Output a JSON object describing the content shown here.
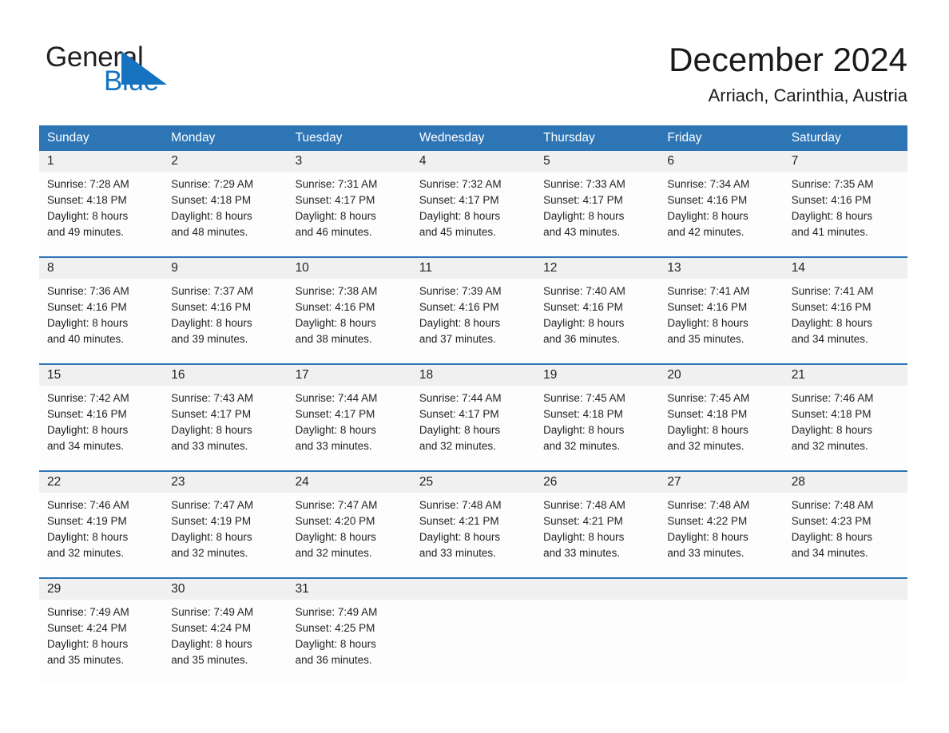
{
  "brand": {
    "name_part1": "General",
    "name_part2": "Blue",
    "triangle_icon": "blue-triangle-icon",
    "accent_color": "#1673c0"
  },
  "header": {
    "title": "December 2024",
    "subtitle": "Arriach, Carinthia, Austria"
  },
  "theme": {
    "header_blue": "#2e75b6",
    "date_band_gray": "#f0f0f0",
    "text_dark": "#231f20"
  },
  "calendar": {
    "day_headers": [
      "Sunday",
      "Monday",
      "Tuesday",
      "Wednesday",
      "Thursday",
      "Friday",
      "Saturday"
    ],
    "weeks": [
      [
        {
          "day": "1",
          "sunrise": "Sunrise: 7:28 AM",
          "sunset": "Sunset: 4:18 PM",
          "daylight_line1": "Daylight: 8 hours",
          "daylight_line2": "and 49 minutes."
        },
        {
          "day": "2",
          "sunrise": "Sunrise: 7:29 AM",
          "sunset": "Sunset: 4:18 PM",
          "daylight_line1": "Daylight: 8 hours",
          "daylight_line2": "and 48 minutes."
        },
        {
          "day": "3",
          "sunrise": "Sunrise: 7:31 AM",
          "sunset": "Sunset: 4:17 PM",
          "daylight_line1": "Daylight: 8 hours",
          "daylight_line2": "and 46 minutes."
        },
        {
          "day": "4",
          "sunrise": "Sunrise: 7:32 AM",
          "sunset": "Sunset: 4:17 PM",
          "daylight_line1": "Daylight: 8 hours",
          "daylight_line2": "and 45 minutes."
        },
        {
          "day": "5",
          "sunrise": "Sunrise: 7:33 AM",
          "sunset": "Sunset: 4:17 PM",
          "daylight_line1": "Daylight: 8 hours",
          "daylight_line2": "and 43 minutes."
        },
        {
          "day": "6",
          "sunrise": "Sunrise: 7:34 AM",
          "sunset": "Sunset: 4:16 PM",
          "daylight_line1": "Daylight: 8 hours",
          "daylight_line2": "and 42 minutes."
        },
        {
          "day": "7",
          "sunrise": "Sunrise: 7:35 AM",
          "sunset": "Sunset: 4:16 PM",
          "daylight_line1": "Daylight: 8 hours",
          "daylight_line2": "and 41 minutes."
        }
      ],
      [
        {
          "day": "8",
          "sunrise": "Sunrise: 7:36 AM",
          "sunset": "Sunset: 4:16 PM",
          "daylight_line1": "Daylight: 8 hours",
          "daylight_line2": "and 40 minutes."
        },
        {
          "day": "9",
          "sunrise": "Sunrise: 7:37 AM",
          "sunset": "Sunset: 4:16 PM",
          "daylight_line1": "Daylight: 8 hours",
          "daylight_line2": "and 39 minutes."
        },
        {
          "day": "10",
          "sunrise": "Sunrise: 7:38 AM",
          "sunset": "Sunset: 4:16 PM",
          "daylight_line1": "Daylight: 8 hours",
          "daylight_line2": "and 38 minutes."
        },
        {
          "day": "11",
          "sunrise": "Sunrise: 7:39 AM",
          "sunset": "Sunset: 4:16 PM",
          "daylight_line1": "Daylight: 8 hours",
          "daylight_line2": "and 37 minutes."
        },
        {
          "day": "12",
          "sunrise": "Sunrise: 7:40 AM",
          "sunset": "Sunset: 4:16 PM",
          "daylight_line1": "Daylight: 8 hours",
          "daylight_line2": "and 36 minutes."
        },
        {
          "day": "13",
          "sunrise": "Sunrise: 7:41 AM",
          "sunset": "Sunset: 4:16 PM",
          "daylight_line1": "Daylight: 8 hours",
          "daylight_line2": "and 35 minutes."
        },
        {
          "day": "14",
          "sunrise": "Sunrise: 7:41 AM",
          "sunset": "Sunset: 4:16 PM",
          "daylight_line1": "Daylight: 8 hours",
          "daylight_line2": "and 34 minutes."
        }
      ],
      [
        {
          "day": "15",
          "sunrise": "Sunrise: 7:42 AM",
          "sunset": "Sunset: 4:16 PM",
          "daylight_line1": "Daylight: 8 hours",
          "daylight_line2": "and 34 minutes."
        },
        {
          "day": "16",
          "sunrise": "Sunrise: 7:43 AM",
          "sunset": "Sunset: 4:17 PM",
          "daylight_line1": "Daylight: 8 hours",
          "daylight_line2": "and 33 minutes."
        },
        {
          "day": "17",
          "sunrise": "Sunrise: 7:44 AM",
          "sunset": "Sunset: 4:17 PM",
          "daylight_line1": "Daylight: 8 hours",
          "daylight_line2": "and 33 minutes."
        },
        {
          "day": "18",
          "sunrise": "Sunrise: 7:44 AM",
          "sunset": "Sunset: 4:17 PM",
          "daylight_line1": "Daylight: 8 hours",
          "daylight_line2": "and 32 minutes."
        },
        {
          "day": "19",
          "sunrise": "Sunrise: 7:45 AM",
          "sunset": "Sunset: 4:18 PM",
          "daylight_line1": "Daylight: 8 hours",
          "daylight_line2": "and 32 minutes."
        },
        {
          "day": "20",
          "sunrise": "Sunrise: 7:45 AM",
          "sunset": "Sunset: 4:18 PM",
          "daylight_line1": "Daylight: 8 hours",
          "daylight_line2": "and 32 minutes."
        },
        {
          "day": "21",
          "sunrise": "Sunrise: 7:46 AM",
          "sunset": "Sunset: 4:18 PM",
          "daylight_line1": "Daylight: 8 hours",
          "daylight_line2": "and 32 minutes."
        }
      ],
      [
        {
          "day": "22",
          "sunrise": "Sunrise: 7:46 AM",
          "sunset": "Sunset: 4:19 PM",
          "daylight_line1": "Daylight: 8 hours",
          "daylight_line2": "and 32 minutes."
        },
        {
          "day": "23",
          "sunrise": "Sunrise: 7:47 AM",
          "sunset": "Sunset: 4:19 PM",
          "daylight_line1": "Daylight: 8 hours",
          "daylight_line2": "and 32 minutes."
        },
        {
          "day": "24",
          "sunrise": "Sunrise: 7:47 AM",
          "sunset": "Sunset: 4:20 PM",
          "daylight_line1": "Daylight: 8 hours",
          "daylight_line2": "and 32 minutes."
        },
        {
          "day": "25",
          "sunrise": "Sunrise: 7:48 AM",
          "sunset": "Sunset: 4:21 PM",
          "daylight_line1": "Daylight: 8 hours",
          "daylight_line2": "and 33 minutes."
        },
        {
          "day": "26",
          "sunrise": "Sunrise: 7:48 AM",
          "sunset": "Sunset: 4:21 PM",
          "daylight_line1": "Daylight: 8 hours",
          "daylight_line2": "and 33 minutes."
        },
        {
          "day": "27",
          "sunrise": "Sunrise: 7:48 AM",
          "sunset": "Sunset: 4:22 PM",
          "daylight_line1": "Daylight: 8 hours",
          "daylight_line2": "and 33 minutes."
        },
        {
          "day": "28",
          "sunrise": "Sunrise: 7:48 AM",
          "sunset": "Sunset: 4:23 PM",
          "daylight_line1": "Daylight: 8 hours",
          "daylight_line2": "and 34 minutes."
        }
      ],
      [
        {
          "day": "29",
          "sunrise": "Sunrise: 7:49 AM",
          "sunset": "Sunset: 4:24 PM",
          "daylight_line1": "Daylight: 8 hours",
          "daylight_line2": "and 35 minutes."
        },
        {
          "day": "30",
          "sunrise": "Sunrise: 7:49 AM",
          "sunset": "Sunset: 4:24 PM",
          "daylight_line1": "Daylight: 8 hours",
          "daylight_line2": "and 35 minutes."
        },
        {
          "day": "31",
          "sunrise": "Sunrise: 7:49 AM",
          "sunset": "Sunset: 4:25 PM",
          "daylight_line1": "Daylight: 8 hours",
          "daylight_line2": "and 36 minutes."
        },
        {
          "day": "",
          "sunrise": "",
          "sunset": "",
          "daylight_line1": "",
          "daylight_line2": ""
        },
        {
          "day": "",
          "sunrise": "",
          "sunset": "",
          "daylight_line1": "",
          "daylight_line2": ""
        },
        {
          "day": "",
          "sunrise": "",
          "sunset": "",
          "daylight_line1": "",
          "daylight_line2": ""
        },
        {
          "day": "",
          "sunrise": "",
          "sunset": "",
          "daylight_line1": "",
          "daylight_line2": ""
        }
      ]
    ]
  }
}
